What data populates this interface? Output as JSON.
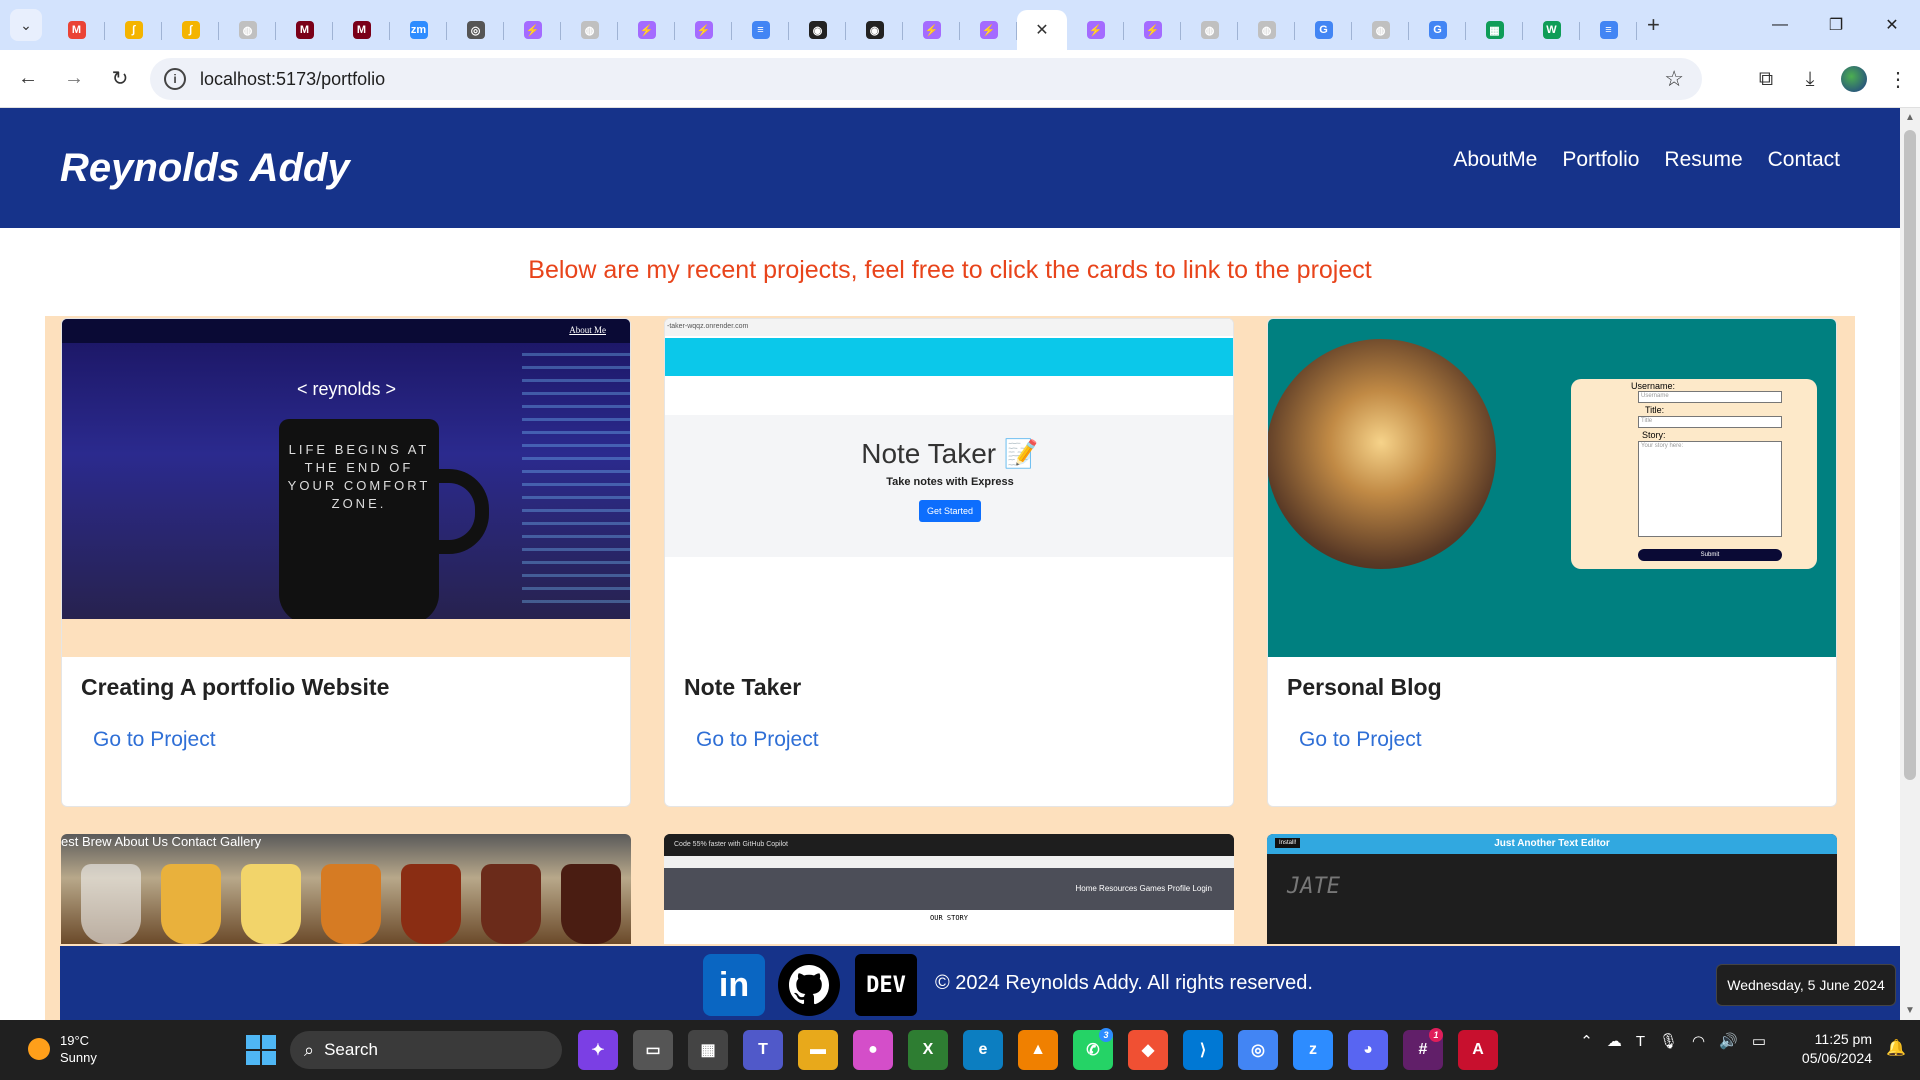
{
  "browser": {
    "tabs": [
      {
        "icon": "chevron-down-icon",
        "color": "#e8effd",
        "glyph": "⌄"
      },
      {
        "icon": "gmail-icon",
        "color": "#ea4335",
        "glyph": "M"
      },
      {
        "icon": "script-icon",
        "color": "#f4b400",
        "glyph": "∫"
      },
      {
        "icon": "script-icon",
        "color": "#f4b400",
        "glyph": "∫"
      },
      {
        "icon": "globe-icon",
        "color": "#c0c0c0",
        "glyph": "◍"
      },
      {
        "icon": "umn-icon",
        "color": "#7a0019",
        "glyph": "M"
      },
      {
        "icon": "umn-icon",
        "color": "#7a0019",
        "glyph": "M"
      },
      {
        "icon": "zoom-icon",
        "color": "#2d8cff",
        "glyph": "zm"
      },
      {
        "icon": "chrome-icon",
        "color": "#555",
        "glyph": "◎"
      },
      {
        "icon": "vite-icon",
        "color": "#a46bff",
        "glyph": "⚡"
      },
      {
        "icon": "globe-icon",
        "color": "#c0c0c0",
        "glyph": "◍"
      },
      {
        "icon": "vite-icon",
        "color": "#a46bff",
        "glyph": "⚡"
      },
      {
        "icon": "vite-icon",
        "color": "#a46bff",
        "glyph": "⚡"
      },
      {
        "icon": "docs-icon",
        "color": "#4285f4",
        "glyph": "≡"
      },
      {
        "icon": "github-icon",
        "color": "#222",
        "glyph": "◉"
      },
      {
        "icon": "github-icon",
        "color": "#222",
        "glyph": "◉"
      },
      {
        "icon": "vite-icon",
        "color": "#a46bff",
        "glyph": "⚡"
      },
      {
        "icon": "vite-icon",
        "color": "#a46bff",
        "glyph": "⚡"
      }
    ],
    "tabs_after": [
      {
        "icon": "vite-icon",
        "color": "#a46bff",
        "glyph": "⚡"
      },
      {
        "icon": "vite-icon",
        "color": "#a46bff",
        "glyph": "⚡"
      },
      {
        "icon": "globe-icon",
        "color": "#c0c0c0",
        "glyph": "◍"
      },
      {
        "icon": "globe-icon",
        "color": "#c0c0c0",
        "glyph": "◍"
      },
      {
        "icon": "google-icon",
        "color": "#4285f4",
        "glyph": "G"
      },
      {
        "icon": "globe-icon",
        "color": "#c0c0c0",
        "glyph": "◍"
      },
      {
        "icon": "google-icon",
        "color": "#4285f4",
        "glyph": "G"
      },
      {
        "icon": "sheets-icon",
        "color": "#0f9d58",
        "glyph": "▦"
      },
      {
        "icon": "w-icon",
        "color": "#0f9d58",
        "glyph": "W"
      },
      {
        "icon": "docs-icon",
        "color": "#4285f4",
        "glyph": "≡"
      }
    ],
    "url": "localhost:5173/portfolio"
  },
  "site": {
    "brand": "Reynolds Addy",
    "nav": [
      "AboutMe",
      "Portfolio",
      "Resume",
      "Contact"
    ],
    "intro": "Below are my recent projects, feel free to click the cards to link to the project",
    "cards": [
      {
        "title": "Creating A portfolio Website",
        "link": "Go to Project"
      },
      {
        "title": "Note Taker",
        "link": "Go to Project"
      },
      {
        "title": "Personal Blog",
        "link": "Go to Project"
      }
    ],
    "card1_img": {
      "about": "About Me",
      "logo": "< reynolds >",
      "mug_lines": "LIFE BEGINS AT THE END OF YOUR COMFORT ZONE."
    },
    "card2_img": {
      "urlbar": "-taker-wqqz.onrender.com",
      "heading": "Note Taker",
      "sub": "Take notes with Express",
      "button": "Get Started"
    },
    "card3_img": {
      "username": "Username:",
      "username_ph": "Username",
      "title": "Title:",
      "title_ph": "Title",
      "story": "Story:",
      "story_ph": "Your story here:",
      "submit": "Submit"
    },
    "row2": {
      "brew_nav": "est Brew   About Us   Contact   Gallery",
      "tiktok_tab": "Code 55% faster with GitHub Copilot",
      "tiktok_nav": "Home  Resources  Games  Profile  Login",
      "tiktok_story": "OUR STORY",
      "jate_title": "Just Another Text Editor",
      "jate_install": "Install!",
      "jate_logo": "JATE"
    },
    "footer": {
      "copyright": "© 2024 Reynolds Addy. All rights reserved.",
      "dev": "DEV",
      "linkedin": "in"
    }
  },
  "tooltip": "Wednesday, 5 June 2024",
  "taskbar": {
    "weather_temp": "19°C",
    "weather_desc": "Sunny",
    "search": "Search",
    "time": "11:25 pm",
    "date": "05/06/2024",
    "badge_whatsapp": "3",
    "badge_slack": "1"
  }
}
